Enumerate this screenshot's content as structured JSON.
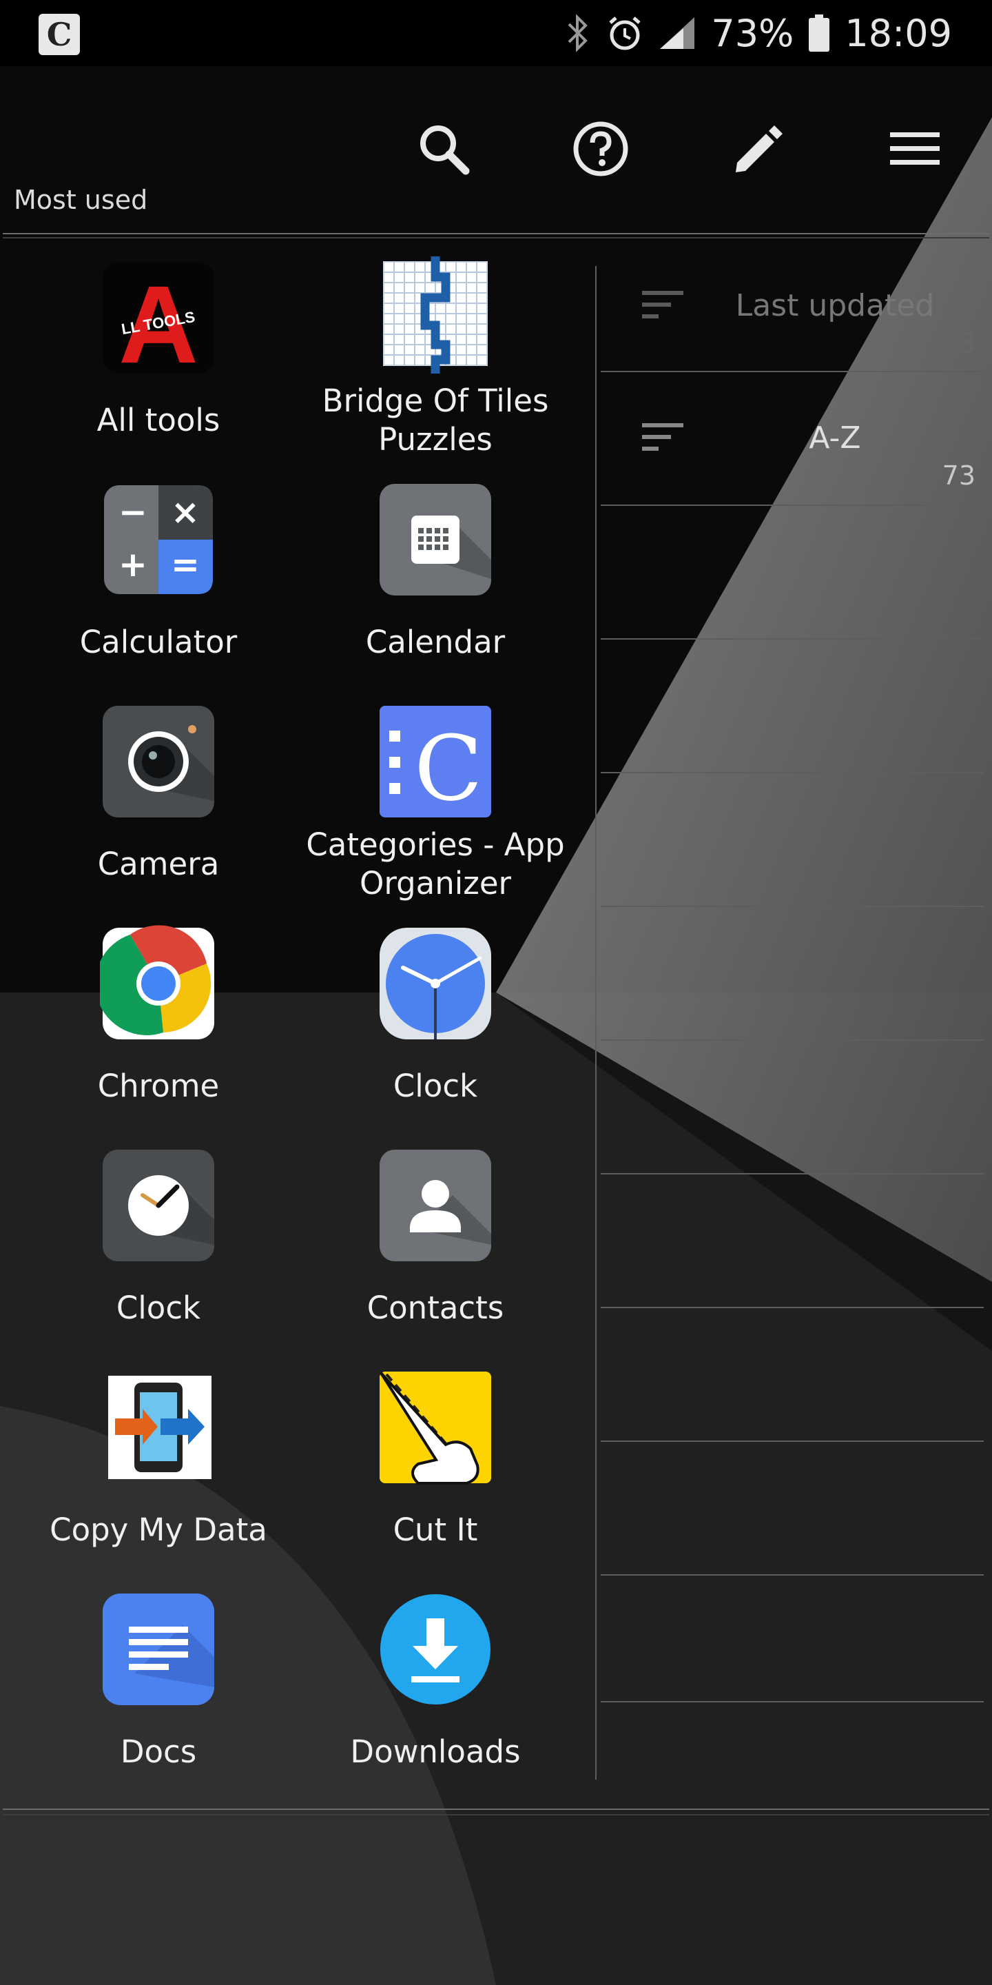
{
  "status_bar": {
    "battery": "73%",
    "time": "18:09"
  },
  "toolbar": {
    "section_label": "Most used"
  },
  "apps": [
    {
      "label": "All tools",
      "icon": "all-tools-icon"
    },
    {
      "label": "Bridge Of Tiles Puzzles",
      "icon": "bridge-of-tiles-icon"
    },
    {
      "label": "Calculator",
      "icon": "calculator-icon"
    },
    {
      "label": "Calendar",
      "icon": "calendar-icon"
    },
    {
      "label": "Camera",
      "icon": "camera-icon"
    },
    {
      "label": "Categories - App Organizer",
      "icon": "categories-icon"
    },
    {
      "label": "Chrome",
      "icon": "chrome-icon"
    },
    {
      "label": "Clock",
      "icon": "clock-icon"
    },
    {
      "label": "Clock",
      "icon": "clock-dark-icon"
    },
    {
      "label": "Contacts",
      "icon": "contacts-icon"
    },
    {
      "label": "Copy My Data",
      "icon": "copy-my-data-icon"
    },
    {
      "label": "Cut It",
      "icon": "cut-it-icon"
    },
    {
      "label": "Docs",
      "icon": "docs-icon"
    },
    {
      "label": "Downloads",
      "icon": "downloads-icon"
    }
  ],
  "sort_options": [
    {
      "label": "Last updated",
      "count": "73"
    },
    {
      "label": "A-Z",
      "count": "73"
    }
  ],
  "icons": {
    "logo_glyph": "C",
    "calendar_grid": "▒",
    "calc_minus": "−",
    "calc_times": "×",
    "calc_plus": "+",
    "calc_equals": "=",
    "all_tools_letter": "A",
    "all_tools_caption": "LL TOOLS"
  },
  "colors": {
    "accent_blue": "#4c82f0",
    "categories_blue": "#5d7ff2",
    "cut_it_yellow": "#fdd301",
    "downloads_blue": "#22a7ee"
  }
}
